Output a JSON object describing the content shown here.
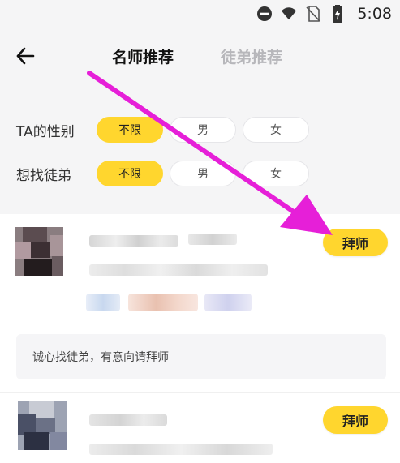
{
  "status_bar": {
    "time": "5:08",
    "icons": [
      "do-not-disturb-icon",
      "wifi-icon",
      "no-sim-icon",
      "battery-charging-icon"
    ]
  },
  "header": {
    "back_icon": "back-arrow-icon",
    "tabs": [
      {
        "label": "名师推荐",
        "active": true
      },
      {
        "label": "徒弟推荐",
        "active": false
      }
    ]
  },
  "filters": [
    {
      "label": "TA的性别",
      "options": [
        "不限",
        "男",
        "女"
      ],
      "selected": "不限"
    },
    {
      "label": "想找徒弟",
      "options": [
        "不限",
        "男",
        "女"
      ],
      "selected": "不限"
    }
  ],
  "cards": [
    {
      "name": "",
      "button_label": "拜师",
      "intro": "诚心找徒弟，有意向请拜师"
    },
    {
      "name": "",
      "button_label": "拜师"
    }
  ],
  "colors": {
    "accent": "#ffd62e",
    "annotation_arrow": "#e61fd8",
    "inactive_tab": "#b7b7bb"
  }
}
